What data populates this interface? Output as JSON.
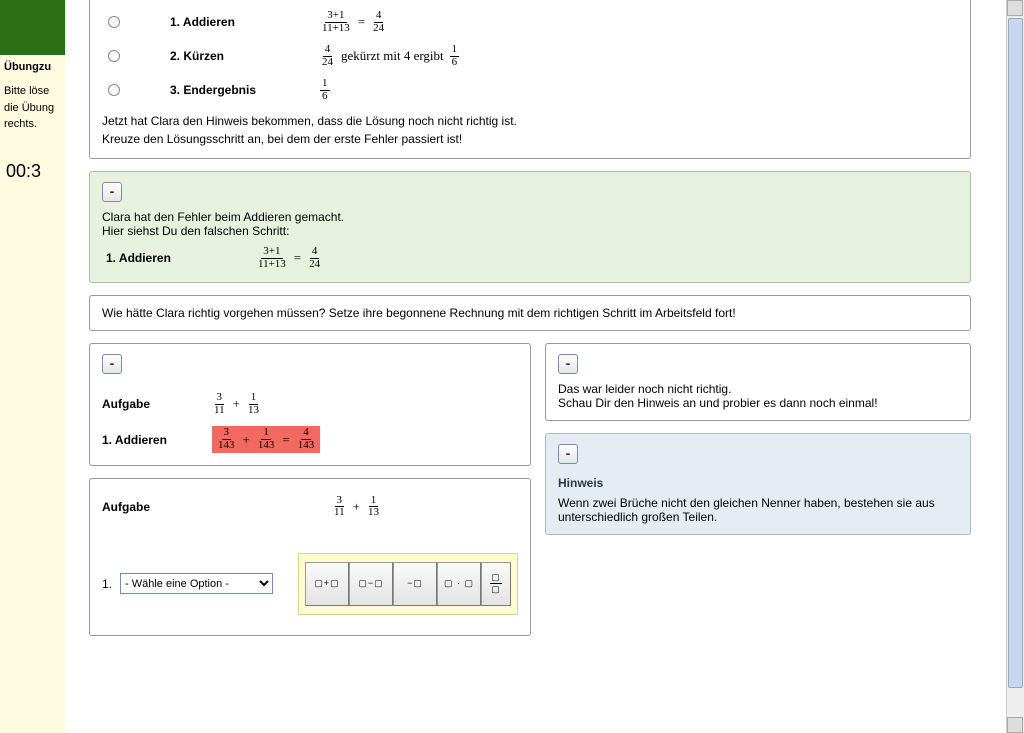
{
  "sidebar": {
    "title": "Übungzu",
    "text": "Bitte löse die Übung rechts.",
    "timer": "00:3"
  },
  "steps": [
    {
      "label": "1. Addieren"
    },
    {
      "label": "2. Kürzen"
    },
    {
      "label": "3. Endergebnis"
    }
  ],
  "math": {
    "s1_num": "3+1",
    "s1_den": "11+13",
    "s1_rnum": "4",
    "s1_rden": "24",
    "s2_lnum": "4",
    "s2_lden": "24",
    "s2_text": "gekürzt mit 4 ergibt",
    "s2_rnum": "1",
    "s2_rden": "6",
    "s3_num": "1",
    "s3_den": "6"
  },
  "instr1a": "Jetzt hat Clara den Hinweis bekommen, dass die Lösung noch nicht richtig ist.",
  "instr1b": "Kreuze den Lösungsschritt an, bei dem der erste Fehler passiert ist!",
  "green": {
    "collapse": "-",
    "l1": "Clara hat den Fehler beim Addieren gemacht.",
    "l2": "Hier siehst Du den falschen Schritt:",
    "step_label": "1. Addieren",
    "num": "3+1",
    "den": "11+13",
    "rnum": "4",
    "rden": "24"
  },
  "instr2": "Wie hätte Clara richtig vorgehen müssen? Setze ihre begonnene Rechnung mit dem richtigen Schritt im Arbeitsfeld fort!",
  "work1": {
    "collapse": "-",
    "aufgabe": "Aufgabe",
    "a_n1": "3",
    "a_d1": "11",
    "a_n2": "1",
    "a_d2": "13",
    "step_label": "1. Addieren",
    "r_n1": "3",
    "r_d1": "143",
    "r_n2": "1",
    "r_d2": "143",
    "r_n3": "4",
    "r_d3": "143"
  },
  "feedback": {
    "collapse": "-",
    "l1": "Das war leider noch nicht richtig.",
    "l2": "Schau Dir den Hinweis an und probier es dann noch einmal!"
  },
  "hint": {
    "collapse": "-",
    "title": "Hinweis",
    "text": "Wenn zwei Brüche nicht den gleichen Nenner haben, bestehen sie aus unterschiedlich großen Teilen."
  },
  "work2": {
    "aufgabe": "Aufgabe",
    "a_n1": "3",
    "a_d1": "11",
    "a_n2": "1",
    "a_d2": "13",
    "idx": "1.",
    "select": "- Wähle eine Option -"
  },
  "tools": {
    "t1": "▢+▢",
    "t2": "▢−▢",
    "t3": "−▢",
    "t4": "▢ · ▢"
  }
}
